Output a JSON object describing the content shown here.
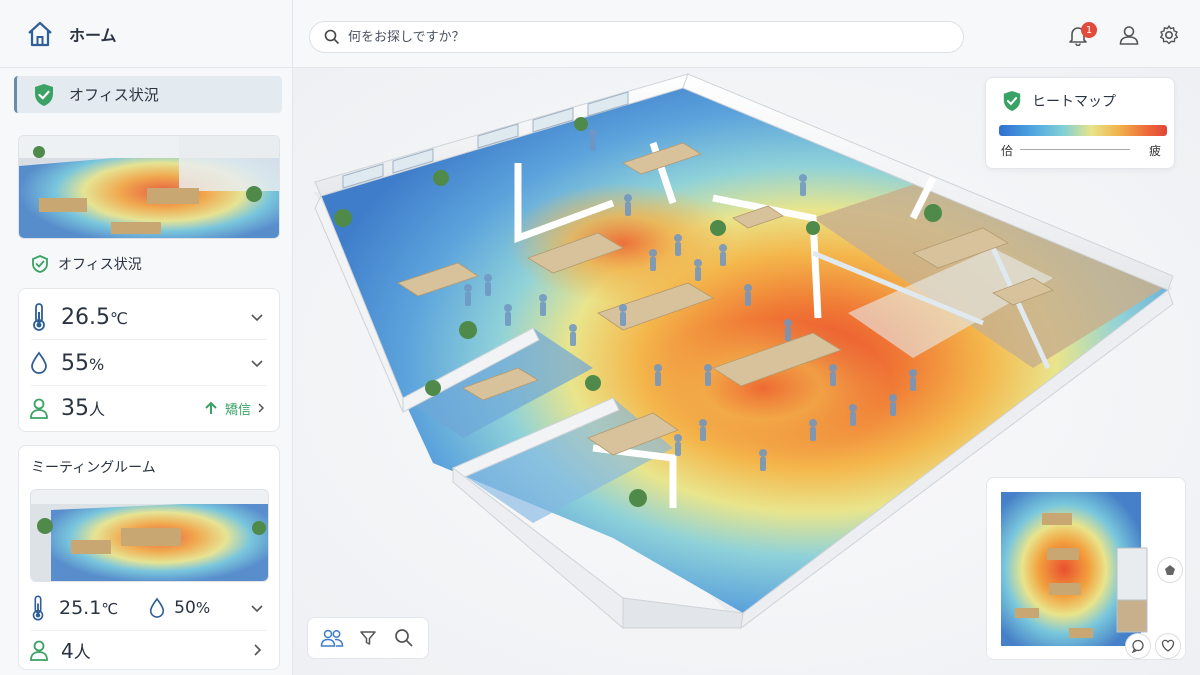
{
  "nav": {
    "home_label": "ホーム",
    "active_item_label": "オフィス状況"
  },
  "search": {
    "placeholder": "何をお探しですか？"
  },
  "notifications": {
    "count": "1"
  },
  "office": {
    "section_title": "オフィス状況",
    "temperature": "26.5",
    "temperature_unit": "℃",
    "humidity": "55",
    "humidity_unit": "%",
    "occupancy": "35",
    "occupancy_unit": "人",
    "occupancy_trend_label": "矯信"
  },
  "meeting_room": {
    "title": "ミーティングルーム",
    "temperature": "25.1",
    "temperature_unit": "℃",
    "humidity": "50",
    "humidity_unit": "%",
    "occupancy": "4",
    "occupancy_unit": "人"
  },
  "heatmap_legend": {
    "title": "ヒートマップ",
    "low_label": "佮",
    "high_label": "疲",
    "colors": [
      "#2f6fd0",
      "#4fa6e0",
      "#7fd0d6",
      "#e8e48a",
      "#f2b04a",
      "#ee6a3a",
      "#e04636"
    ]
  },
  "colors": {
    "accent_green": "#3aa264",
    "brand_blue": "#2f6fd0",
    "badge_red": "#e24a3b"
  },
  "icons": {
    "home": "home-icon",
    "status": "shield-check-icon",
    "temperature": "thermometer-icon",
    "humidity": "droplet-icon",
    "people": "person-icon",
    "trend": "arrow-up-icon",
    "search": "search-icon",
    "bell": "bell-icon",
    "user": "user-icon",
    "settings": "gear-icon",
    "people_group": "people-icon",
    "filter": "filter-icon",
    "zoom": "search-icon",
    "compass": "compass-icon",
    "chat": "chat-icon",
    "favorite": "heart-icon"
  }
}
